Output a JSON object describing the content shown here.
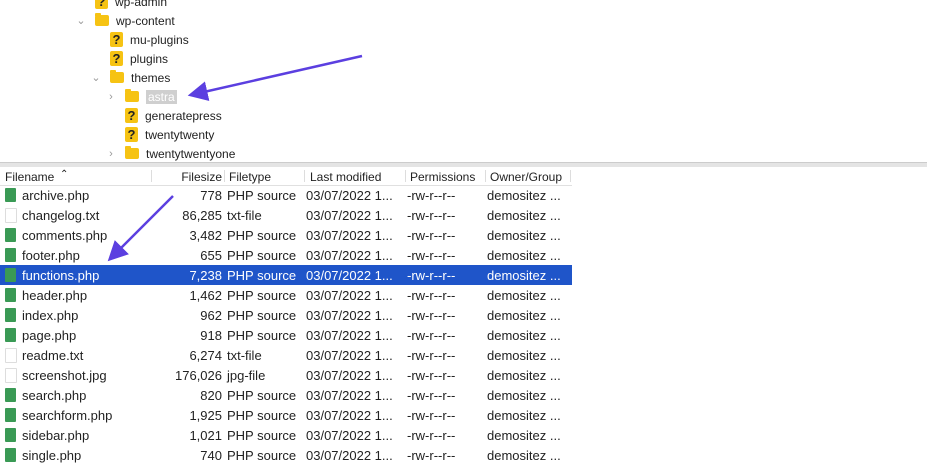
{
  "tree": [
    {
      "label": "wp-admin",
      "type": "unknown"
    },
    {
      "label": "wp-content",
      "type": "folder",
      "expanded": true
    },
    {
      "label": "mu-plugins",
      "type": "unknown"
    },
    {
      "label": "plugins",
      "type": "unknown"
    },
    {
      "label": "themes",
      "type": "folder",
      "expanded": true
    },
    {
      "label": "astra",
      "type": "folder",
      "collapsed": true,
      "selected": true
    },
    {
      "label": "generatepress",
      "type": "unknown"
    },
    {
      "label": "twentytwenty",
      "type": "unknown"
    },
    {
      "label": "twentytwentyone",
      "type": "folder",
      "collapsed": true
    }
  ],
  "columns": {
    "filename": "Filename",
    "filesize": "Filesize",
    "filetype": "Filetype",
    "modified": "Last modified",
    "permissions": "Permissions",
    "owner": "Owner/Group"
  },
  "files": [
    {
      "name": "archive.php",
      "size": "778",
      "type": "PHP source",
      "modified": "03/07/2022 1...",
      "perm": "-rw-r--r--",
      "owner": "demositez ..."
    },
    {
      "name": "changelog.txt",
      "size": "86,285",
      "type": "txt-file",
      "modified": "03/07/2022 1...",
      "perm": "-rw-r--r--",
      "owner": "demositez ..."
    },
    {
      "name": "comments.php",
      "size": "3,482",
      "type": "PHP source",
      "modified": "03/07/2022 1...",
      "perm": "-rw-r--r--",
      "owner": "demositez ..."
    },
    {
      "name": "footer.php",
      "size": "655",
      "type": "PHP source",
      "modified": "03/07/2022 1...",
      "perm": "-rw-r--r--",
      "owner": "demositez ..."
    },
    {
      "name": "functions.php",
      "size": "7,238",
      "type": "PHP source",
      "modified": "03/07/2022 1...",
      "perm": "-rw-r--r--",
      "owner": "demositez ...",
      "selected": true
    },
    {
      "name": "header.php",
      "size": "1,462",
      "type": "PHP source",
      "modified": "03/07/2022 1...",
      "perm": "-rw-r--r--",
      "owner": "demositez ..."
    },
    {
      "name": "index.php",
      "size": "962",
      "type": "PHP source",
      "modified": "03/07/2022 1...",
      "perm": "-rw-r--r--",
      "owner": "demositez ..."
    },
    {
      "name": "page.php",
      "size": "918",
      "type": "PHP source",
      "modified": "03/07/2022 1...",
      "perm": "-rw-r--r--",
      "owner": "demositez ..."
    },
    {
      "name": "readme.txt",
      "size": "6,274",
      "type": "txt-file",
      "modified": "03/07/2022 1...",
      "perm": "-rw-r--r--",
      "owner": "demositez ..."
    },
    {
      "name": "screenshot.jpg",
      "size": "176,026",
      "type": "jpg-file",
      "modified": "03/07/2022 1...",
      "perm": "-rw-r--r--",
      "owner": "demositez ..."
    },
    {
      "name": "search.php",
      "size": "820",
      "type": "PHP source",
      "modified": "03/07/2022 1...",
      "perm": "-rw-r--r--",
      "owner": "demositez ..."
    },
    {
      "name": "searchform.php",
      "size": "1,925",
      "type": "PHP source",
      "modified": "03/07/2022 1...",
      "perm": "-rw-r--r--",
      "owner": "demositez ..."
    },
    {
      "name": "sidebar.php",
      "size": "1,021",
      "type": "PHP source",
      "modified": "03/07/2022 1...",
      "perm": "-rw-r--r--",
      "owner": "demositez ..."
    },
    {
      "name": "single.php",
      "size": "740",
      "type": "PHP source",
      "modified": "03/07/2022 1...",
      "perm": "-rw-r--r--",
      "owner": "demositez ..."
    }
  ],
  "colors": {
    "selection": "#1f55c9",
    "arrow": "#5b3fe0",
    "folder": "#f6c313",
    "php_icon": "#3a9a55"
  }
}
